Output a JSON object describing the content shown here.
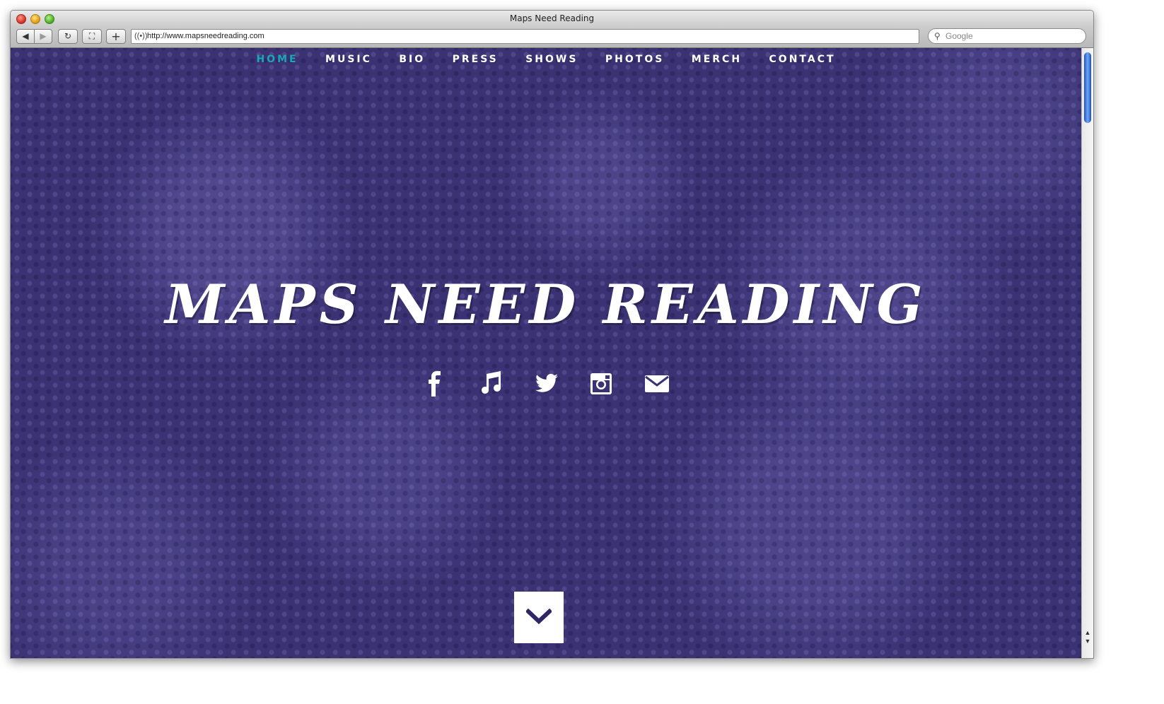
{
  "window": {
    "title": "Maps Need Reading"
  },
  "toolbar": {
    "back_label": "◀",
    "forward_label": "▶",
    "reload_label": "↻",
    "snapback_label": "⛶",
    "add_label": "+",
    "url": "http://www.mapsneedreading.com",
    "search_placeholder": "Google"
  },
  "nav": {
    "items": [
      {
        "label": "HOME",
        "active": true
      },
      {
        "label": "MUSIC"
      },
      {
        "label": "BIO"
      },
      {
        "label": "PRESS"
      },
      {
        "label": "SHOWS"
      },
      {
        "label": "PHOTOS"
      },
      {
        "label": "MERCH"
      },
      {
        "label": "CONTACT"
      }
    ],
    "active_color": "#1aa7b7"
  },
  "hero": {
    "title": "MAPS NEED READING",
    "background_color": "#3a3273"
  },
  "social": {
    "icons": [
      "facebook-icon",
      "music-note-icon",
      "twitter-icon",
      "instagram-icon",
      "email-icon"
    ]
  },
  "scroll_down": {
    "icon": "chevron-down-icon",
    "icon_color": "#2e2766"
  }
}
